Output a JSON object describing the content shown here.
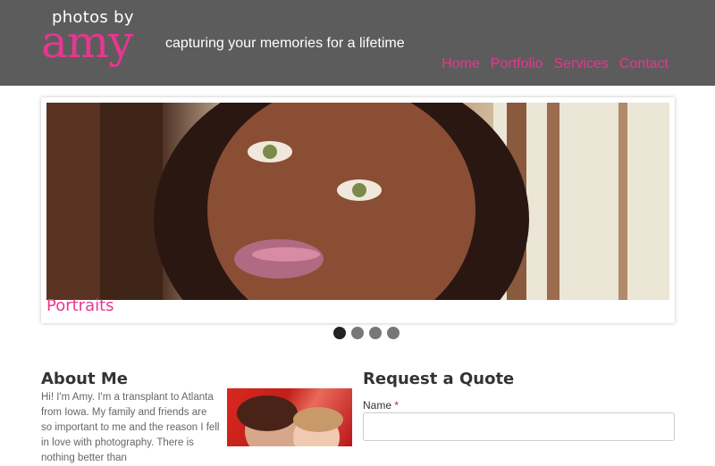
{
  "header": {
    "logo_top": "photos by",
    "logo_main": "amy",
    "tagline": "capturing your memories for a lifetime",
    "nav": [
      "Home",
      "Portfolio",
      "Services",
      "Contact"
    ]
  },
  "slider": {
    "caption": "Portraits",
    "active_index": 0,
    "dot_count": 4
  },
  "about": {
    "title": "About Me",
    "text": "Hi! I'm Amy. I'm a transplant to Atlanta from Iowa. My family and friends are so important to me and the reason I fell in love with photography. There is nothing better than"
  },
  "quote": {
    "title": "Request a Quote",
    "name_label": "Name",
    "required_mark": "*",
    "name_value": ""
  },
  "colors": {
    "accent": "#e8368f",
    "header_bg": "#5c5c5c"
  }
}
